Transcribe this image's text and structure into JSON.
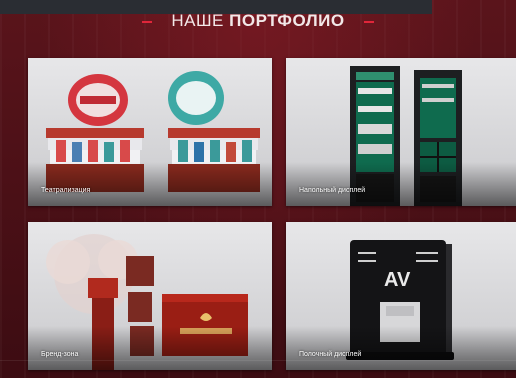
{
  "header": {
    "title_light": "НАШЕ",
    "title_bold": "ПОРТФОЛИО"
  },
  "portfolio": {
    "items": [
      {
        "label": "Театрализация"
      },
      {
        "label": "Напольный дисплей"
      },
      {
        "label": "Бренд-зона"
      },
      {
        "label": "Полочный дисплей"
      }
    ]
  },
  "colors": {
    "background": "#4a1016",
    "accent": "#e0263a",
    "card": "#d9d9dc"
  }
}
